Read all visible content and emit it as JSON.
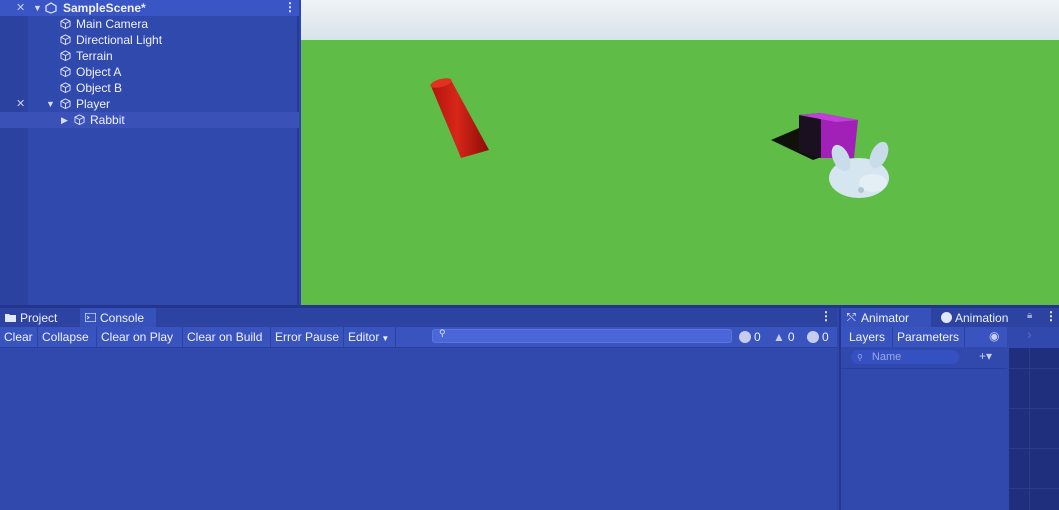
{
  "hierarchy": {
    "scene_name": "SampleScene*",
    "items": [
      {
        "label": "Main Camera"
      },
      {
        "label": "Directional Light"
      },
      {
        "label": "Terrain"
      },
      {
        "label": "Object A"
      },
      {
        "label": "Object B"
      },
      {
        "label": "Player"
      },
      {
        "label": "Rabbit"
      }
    ]
  },
  "console": {
    "tabs": [
      {
        "label": "Project"
      },
      {
        "label": "Console"
      }
    ],
    "toolbar": {
      "clear": "Clear",
      "collapse": "Collapse",
      "clear_on_play": "Clear on Play",
      "clear_on_build": "Clear on Build",
      "error_pause": "Error Pause",
      "editor": "Editor"
    },
    "counts": {
      "info": "0",
      "warnings": "0",
      "errors": "0"
    }
  },
  "animator": {
    "tabs": [
      {
        "label": "Animator"
      },
      {
        "label": "Animation"
      }
    ],
    "subtabs": {
      "layers": "Layers",
      "parameters": "Parameters"
    },
    "search_placeholder": "Name"
  },
  "colors": {
    "panel_blue": "#3149ad",
    "sky": "#dfe8ef",
    "ground": "#5fbd47",
    "cylinder": "#c81a10",
    "cube": "#a020b8"
  }
}
